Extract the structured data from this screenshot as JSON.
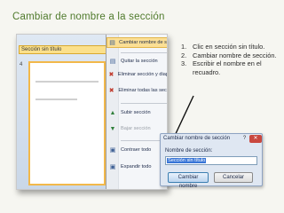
{
  "slide": {
    "title": "Cambiar de nombre a la sección",
    "accent": "#4f7a2c"
  },
  "pane": {
    "section_header": "Sección sin título",
    "slide_number": "4"
  },
  "context_menu": {
    "items": [
      {
        "label": "Cambiar nombre de sección",
        "icon": "rename-section-icon",
        "glyph": "▤",
        "active": true
      },
      {
        "label": "Quitar la sección",
        "icon": "remove-section-icon",
        "glyph": "▤",
        "active": false
      },
      {
        "label": "Eliminar sección y diapositivas",
        "icon": "delete-section-slides-icon",
        "glyph": "✖",
        "active": false
      },
      {
        "label": "Eliminar todas las secciones",
        "icon": "delete-all-sections-icon",
        "glyph": "✖",
        "active": false
      },
      {
        "label": "Subir sección",
        "icon": "move-up-icon",
        "glyph": "▲",
        "active": false
      },
      {
        "label": "Bajar sección",
        "icon": "move-down-icon",
        "glyph": "▼",
        "active": false,
        "disabled": true
      },
      {
        "label": "Contraer todo",
        "icon": "collapse-all-icon",
        "glyph": "▣",
        "active": false
      },
      {
        "label": "Expandir todo",
        "icon": "expand-all-icon",
        "glyph": "▣",
        "active": false
      }
    ]
  },
  "steps": [
    {
      "num": "1.",
      "text": "Clic en sección sin título."
    },
    {
      "num": "2.",
      "text": "Cambiar nombre de sección."
    },
    {
      "num": "3.",
      "text": "Escribir el nombre en el recuadro."
    }
  ],
  "dialog": {
    "title": "Cambiar nombre de sección",
    "help": "?",
    "close": "✕",
    "field_label": "Nombre de sección:",
    "field_value": "Sección sin título",
    "primary_button": "Cambiar nombre",
    "cancel_button": "Cancelar"
  }
}
